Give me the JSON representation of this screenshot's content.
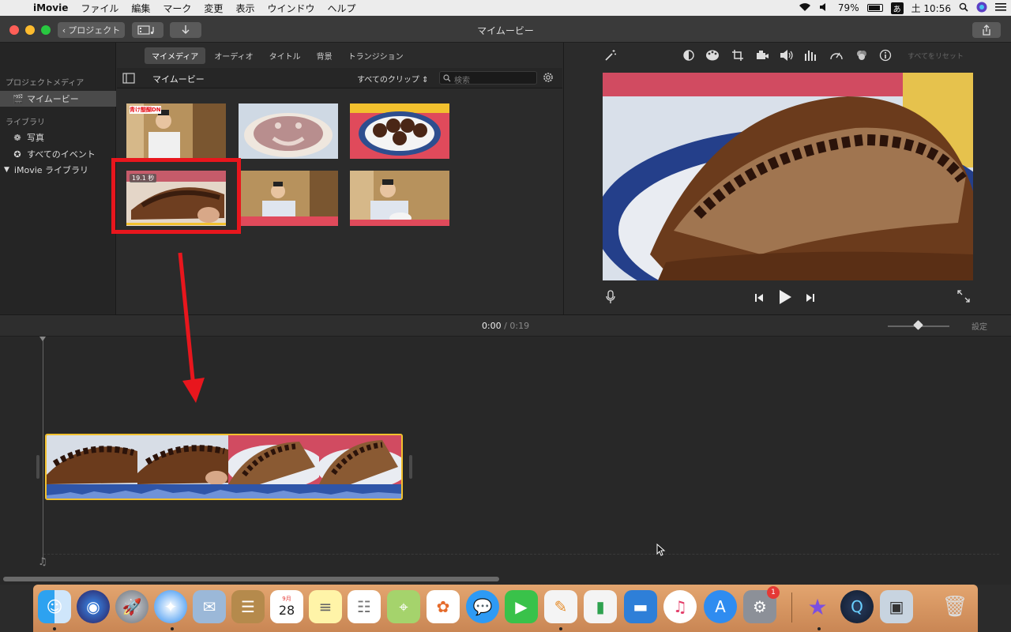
{
  "menubar": {
    "app_name": "iMovie",
    "menus": [
      "ファイル",
      "編集",
      "マーク",
      "変更",
      "表示",
      "ウインドウ",
      "ヘルプ"
    ],
    "battery": "79%",
    "input_method": "あ",
    "clock": "土 10:56"
  },
  "titlebar": {
    "back_button": "プロジェクト",
    "title": "マイムービー"
  },
  "sidebar": {
    "project_media_header": "プロジェクトメディア",
    "project_item": "マイムービー",
    "library_header": "ライブラリ",
    "library_items": [
      "写真",
      "すべてのイベント"
    ],
    "library_name": "iMovie ライブラリ"
  },
  "media_tabs": [
    "マイメディア",
    "オーディオ",
    "タイトル",
    "背景",
    "トランジション"
  ],
  "browser": {
    "event_name": "マイムービー",
    "filter": "すべてのクリップ",
    "search_placeholder": "検索",
    "selected_clip_duration": "19.1 秒",
    "first_clip_caption": "青け醍醐DN"
  },
  "viewer": {
    "reset_all": "すべてをリセット"
  },
  "timeline": {
    "current_time": "0:00",
    "separator": "/",
    "total_time": "0:19",
    "settings": "設定"
  },
  "dock": {
    "calendar_month": "9月",
    "calendar_day": "28",
    "system_prefs_badge": "1"
  },
  "colors": {
    "highlight_red": "#e8161d",
    "clip_border": "#f2c12e",
    "waveform": "#2f55a8"
  }
}
